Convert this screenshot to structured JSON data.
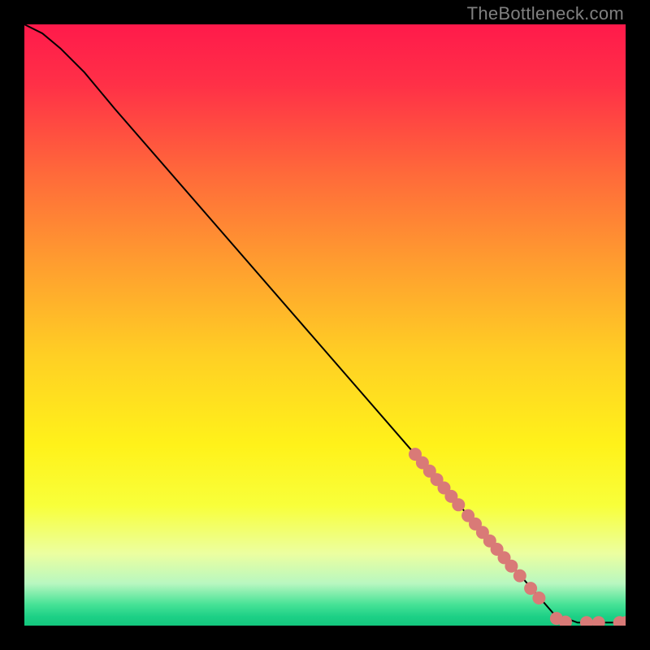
{
  "attribution": "TheBottleneck.com",
  "chart_data": {
    "type": "line",
    "xlabel": "",
    "ylabel": "",
    "xlim": [
      0,
      100
    ],
    "ylim": [
      0,
      100
    ],
    "title": "",
    "curve": [
      {
        "x": 0,
        "y": 100
      },
      {
        "x": 3,
        "y": 98.5
      },
      {
        "x": 6,
        "y": 96
      },
      {
        "x": 10,
        "y": 92
      },
      {
        "x": 15,
        "y": 86
      },
      {
        "x": 88,
        "y": 2
      },
      {
        "x": 92,
        "y": 0.5
      },
      {
        "x": 100,
        "y": 0.5
      }
    ],
    "markers": [
      {
        "x": 65.0,
        "y": 28.5
      },
      {
        "x": 66.2,
        "y": 27.1
      },
      {
        "x": 67.4,
        "y": 25.7
      },
      {
        "x": 68.6,
        "y": 24.3
      },
      {
        "x": 69.8,
        "y": 22.9
      },
      {
        "x": 71.0,
        "y": 21.5
      },
      {
        "x": 72.2,
        "y": 20.1
      },
      {
        "x": 73.8,
        "y": 18.3
      },
      {
        "x": 75.0,
        "y": 16.9
      },
      {
        "x": 76.2,
        "y": 15.5
      },
      {
        "x": 77.4,
        "y": 14.1
      },
      {
        "x": 78.6,
        "y": 12.7
      },
      {
        "x": 79.8,
        "y": 11.3
      },
      {
        "x": 81.0,
        "y": 9.9
      },
      {
        "x": 82.4,
        "y": 8.3
      },
      {
        "x": 84.2,
        "y": 6.2
      },
      {
        "x": 85.6,
        "y": 4.6
      },
      {
        "x": 88.5,
        "y": 1.2
      },
      {
        "x": 90.0,
        "y": 0.6
      },
      {
        "x": 93.5,
        "y": 0.5
      },
      {
        "x": 95.5,
        "y": 0.5
      },
      {
        "x": 99.0,
        "y": 0.5
      },
      {
        "x": 100.0,
        "y": 0.5
      }
    ],
    "gradient_stops": [
      {
        "offset": 0.0,
        "color": "#ff1a4b"
      },
      {
        "offset": 0.1,
        "color": "#ff3047"
      },
      {
        "offset": 0.25,
        "color": "#ff6a3a"
      },
      {
        "offset": 0.4,
        "color": "#ff9e2f"
      },
      {
        "offset": 0.55,
        "color": "#ffcf24"
      },
      {
        "offset": 0.7,
        "color": "#fff21a"
      },
      {
        "offset": 0.8,
        "color": "#f8ff3a"
      },
      {
        "offset": 0.88,
        "color": "#ecffa0"
      },
      {
        "offset": 0.93,
        "color": "#b8f7c0"
      },
      {
        "offset": 0.965,
        "color": "#46e296"
      },
      {
        "offset": 0.985,
        "color": "#1dd086"
      },
      {
        "offset": 1.0,
        "color": "#13c77d"
      }
    ],
    "marker_color": "#d97a77",
    "curve_color": "#000000"
  }
}
